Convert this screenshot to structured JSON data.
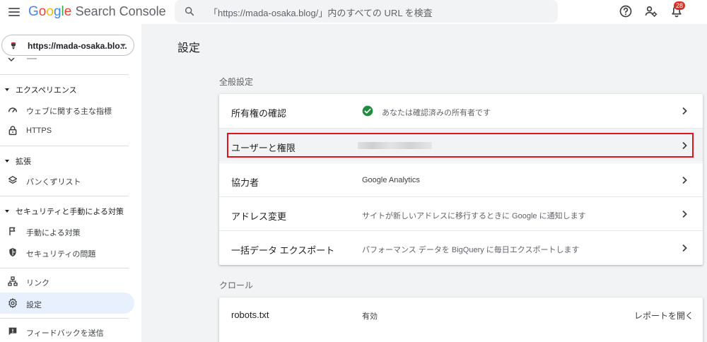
{
  "header": {
    "logo_google": "Google",
    "logo_product": "Search Console",
    "search_placeholder": "「https://mada-osaka.blog/」内のすべての URL を検査",
    "notification_count": "28",
    "icons": [
      "menu-icon",
      "search-icon",
      "help-icon",
      "manage-users-icon",
      "notifications-icon"
    ]
  },
  "sidebar": {
    "property": "https://mada-osaka.blo...",
    "sections": [
      {
        "title": "エクスペリエンス",
        "items": [
          {
            "label": "ウェブに関する主な指標",
            "icon": "speed-gauge-icon"
          },
          {
            "label": "HTTPS",
            "icon": "lock-icon"
          }
        ]
      },
      {
        "title": "拡張",
        "items": [
          {
            "label": "パンくずリスト",
            "icon": "layers-icon"
          }
        ]
      },
      {
        "title": "セキュリティと手動による対策",
        "items": [
          {
            "label": "手動による対策",
            "icon": "flag-icon"
          },
          {
            "label": "セキュリティの問題",
            "icon": "shield-icon"
          }
        ]
      }
    ],
    "links_label": "リンク",
    "settings_label": "設定",
    "feedback_label": "フィードバックを送信"
  },
  "main": {
    "page_title": "設定",
    "general_label": "全般設定",
    "general_rows": [
      {
        "label": "所有権の確認",
        "value": "あなたは確認済みの所有者です"
      },
      {
        "label": "ユーザーと権限",
        "value": ""
      },
      {
        "label": "協力者",
        "value": "Google Analytics"
      },
      {
        "label": "アドレス変更",
        "value": "サイトが新しいアドレスに移行するときに Google に通知します"
      },
      {
        "label": "一括データ エクスポート",
        "value": "パフォーマンス データを BigQuery に毎日エクスポートします"
      }
    ],
    "crawl_label": "クロール",
    "crawl_rows": [
      {
        "label": "robots.txt",
        "value": "有効",
        "action": "レポートを開く"
      }
    ]
  },
  "colors": {
    "accent": "#1a73e8",
    "active_nav_bg": "#e8f0fe",
    "highlight_border": "#e0141e",
    "verified_green": "#1e8e3e",
    "badge_red": "#d93025"
  }
}
